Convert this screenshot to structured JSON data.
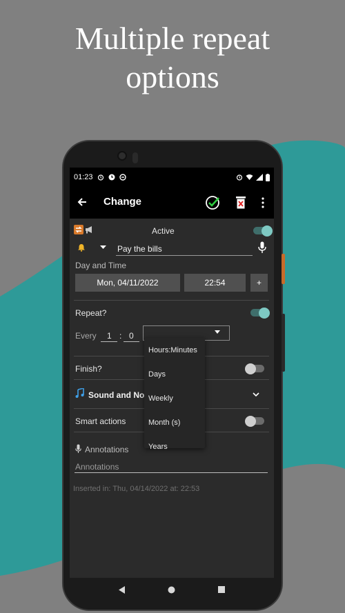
{
  "headline": {
    "line1": "Multiple repeat",
    "line2": "options"
  },
  "colors": {
    "background": "#808080",
    "teal": "#2e9a98",
    "accent": "#7ec9c3",
    "check_green": "#2ecc40",
    "delete_red": "#e02424"
  },
  "statusbar": {
    "time": "01:23",
    "left_icons": [
      "alarm-icon",
      "clock-icon",
      "sync-icon"
    ],
    "right_icons": [
      "alarm-icon",
      "wifi-icon",
      "signal-icon",
      "battery-icon"
    ]
  },
  "appbar": {
    "title": "Change",
    "icons": [
      "back-arrow-icon",
      "check-circle-icon",
      "delete-icon",
      "more-vert-icon"
    ]
  },
  "form": {
    "active_label": "Active",
    "active_on": true,
    "reminder_text": "Pay the bills",
    "day_time_label": "Day and Time",
    "date": "Mon, 04/11/2022",
    "time": "22:54",
    "plus_label": "+",
    "repeat_label": "Repeat?",
    "repeat_on": true,
    "every_label": "Every",
    "every_hours": "1",
    "every_sep": ":",
    "every_minutes": "0",
    "finish_label": "Finish?",
    "finish_on": false,
    "sound_label": "Sound and Not",
    "smart_label": "Smart actions",
    "smart_on": false,
    "annotations_label": "Annotations",
    "annotations_placeholder": "Annotations",
    "inserted": "Inserted in: Thu, 04/14/2022 at: 22:53"
  },
  "repeat_dropdown": {
    "selected": "Hours:Minutes",
    "options": [
      "Hours:Minutes",
      "Days",
      "Weekly",
      "Month (s)",
      "Years"
    ]
  },
  "navbar": {
    "icons": [
      "back-triangle-icon",
      "home-circle-icon",
      "recents-square-icon"
    ]
  }
}
